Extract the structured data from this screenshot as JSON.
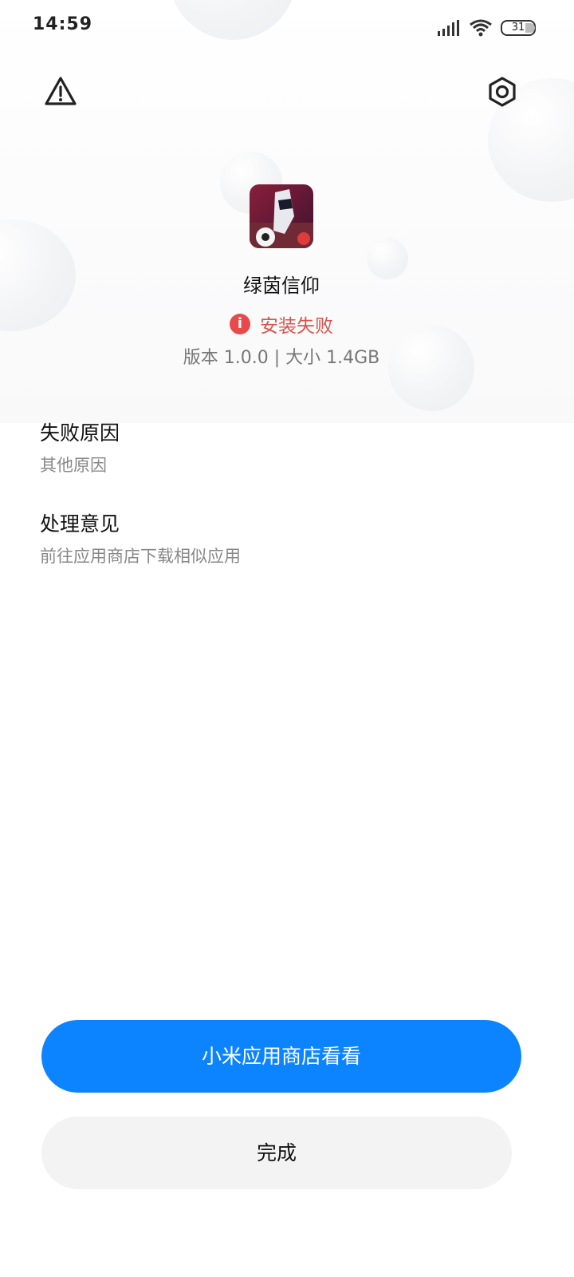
{
  "status_bar": {
    "time": "14:59",
    "battery": "31",
    "icons": [
      "signal-icon",
      "wifi-icon",
      "battery-icon"
    ]
  },
  "header": {
    "left_icon": "warning-icon",
    "right_icon": "settings-hex-icon"
  },
  "app": {
    "name": "绿茵信仰",
    "status": "安装失败",
    "status_icon": "error-info-icon",
    "status_color": "#d8534e",
    "meta": "版本 1.0.0 | 大小 1.4GB"
  },
  "sections": [
    {
      "title": "失败原因",
      "value": "其他原因"
    },
    {
      "title": "处理意见",
      "value": "前往应用商店下载相似应用"
    }
  ],
  "buttons": {
    "primary": "小米应用商店看看",
    "secondary": "完成"
  },
  "colors": {
    "primary_button": "#0d84ff",
    "secondary_button": "#f3f3f4",
    "error": "#e84a4a"
  }
}
